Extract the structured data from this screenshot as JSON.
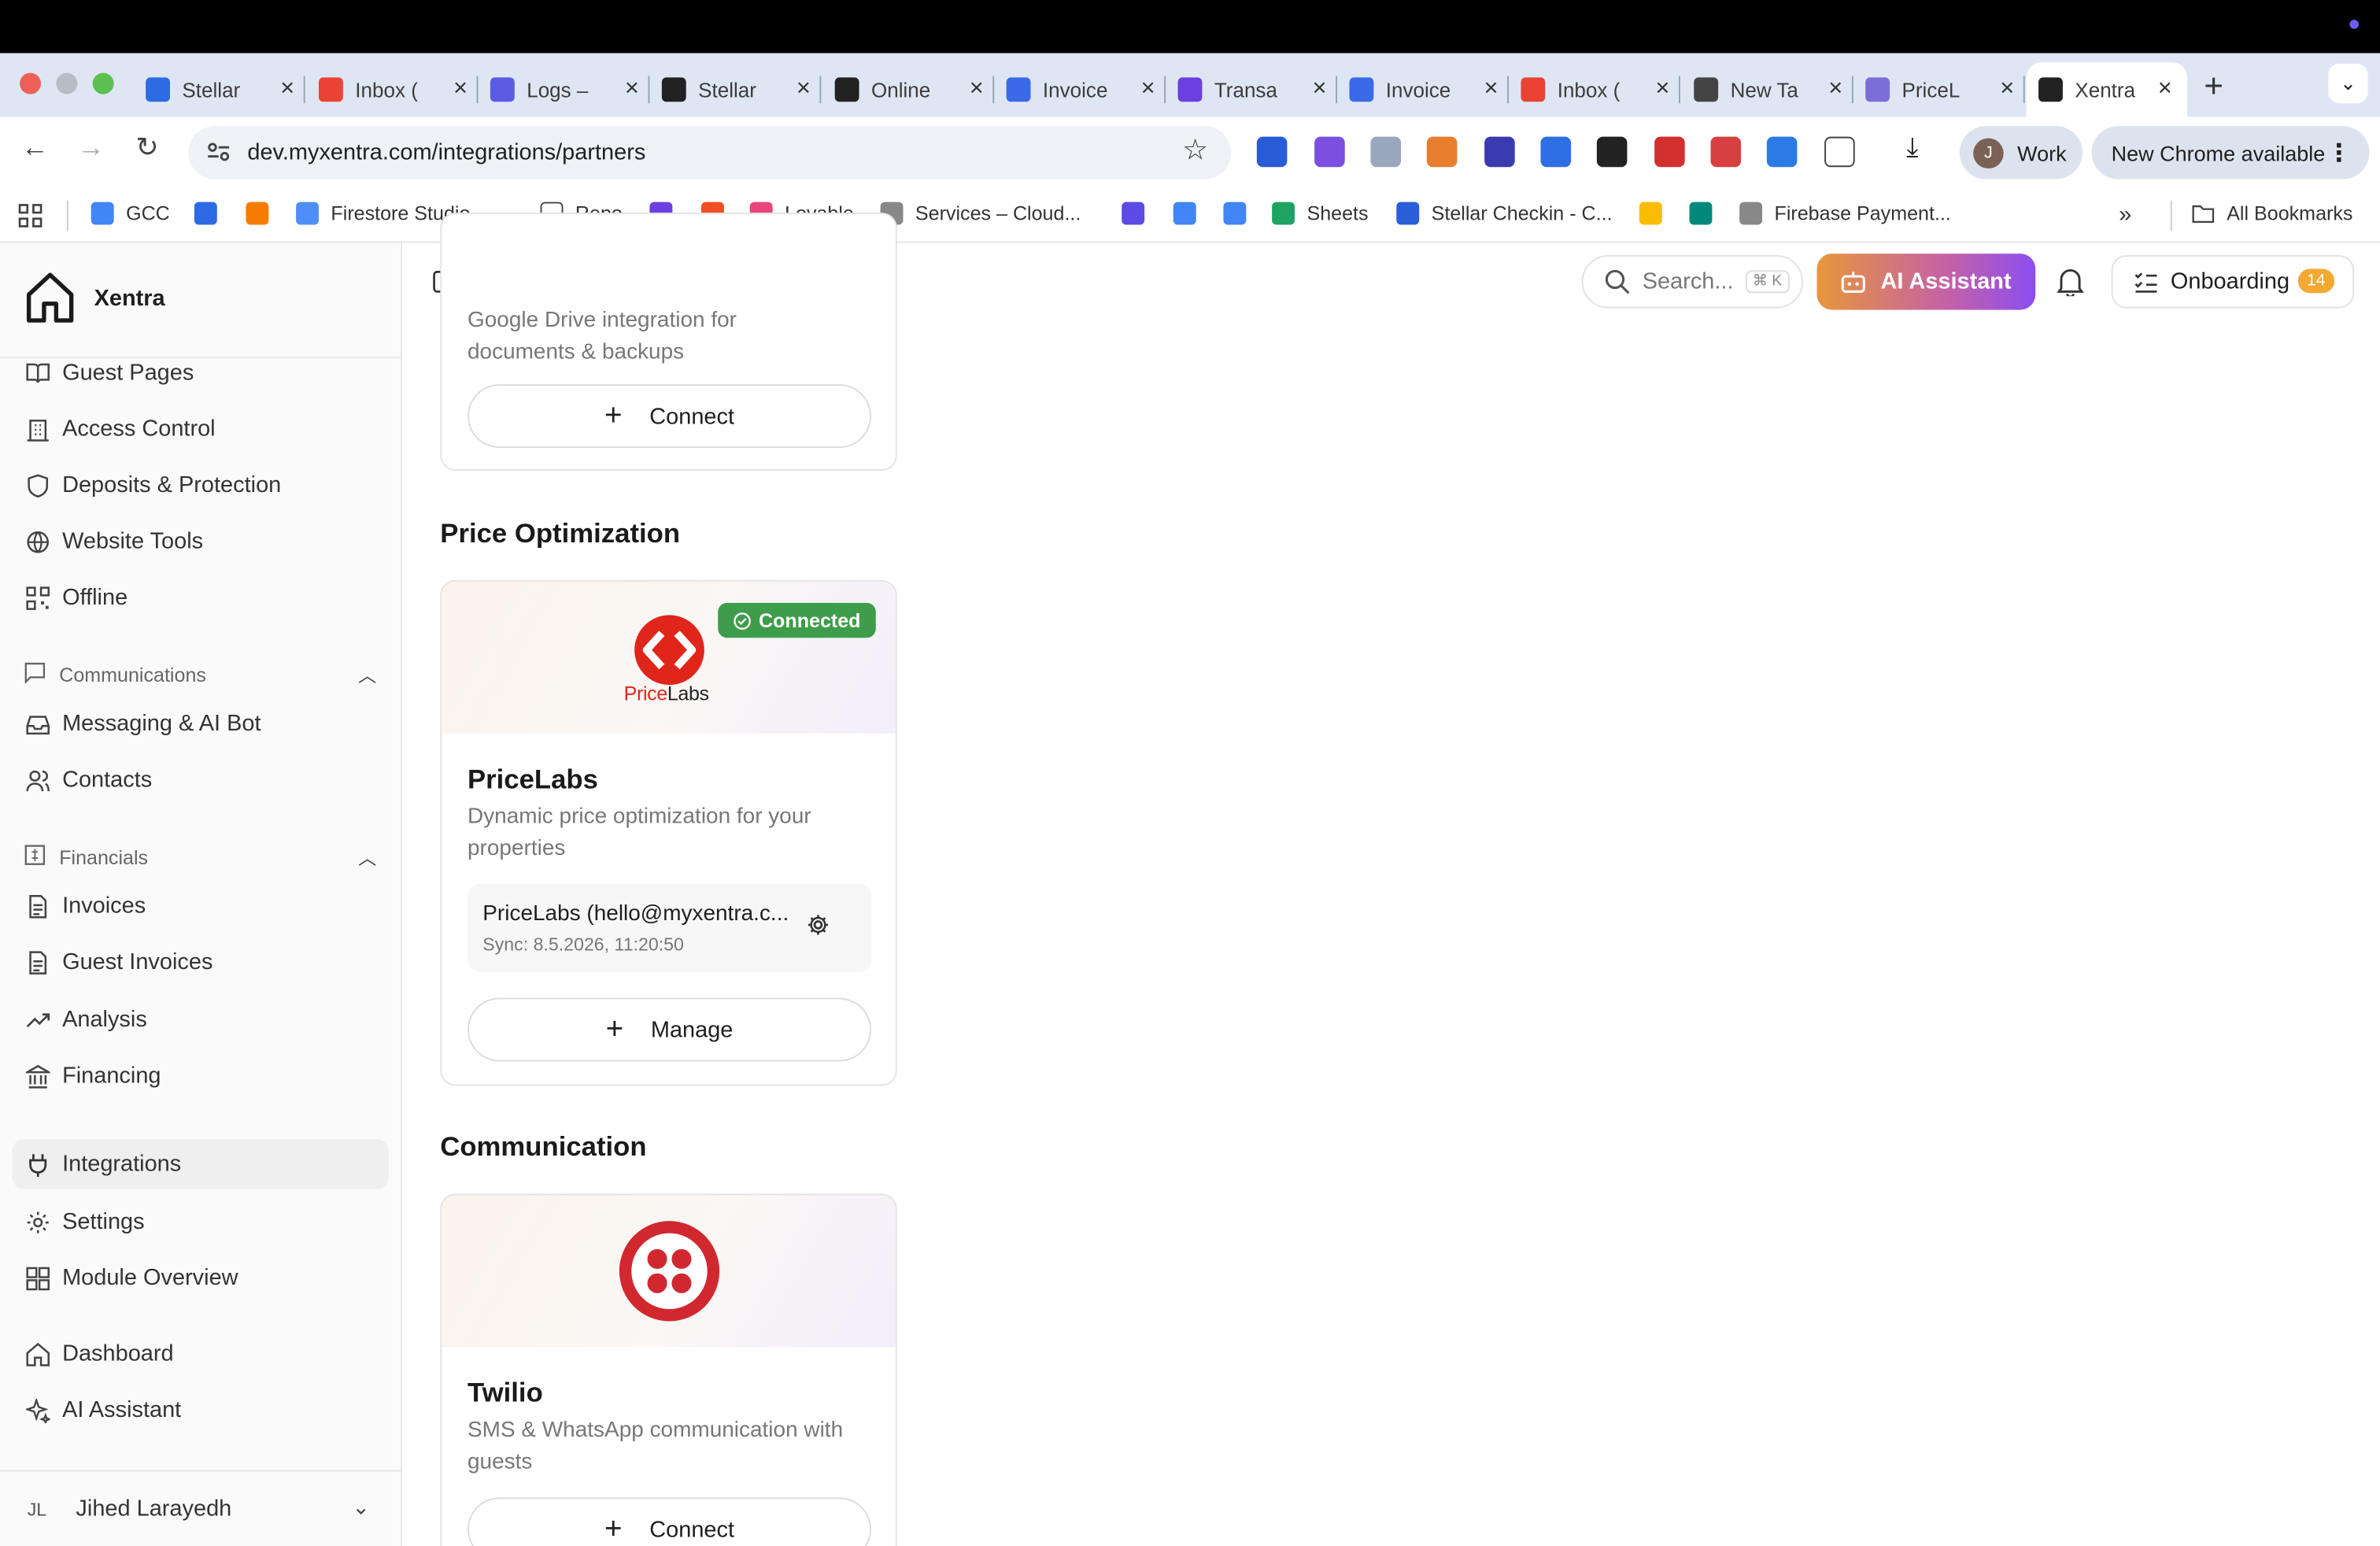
{
  "browser": {
    "tabs": [
      {
        "title": "Stellar",
        "icon": "stellar-tab-icon",
        "color": "#2d6be4"
      },
      {
        "title": "Inbox (",
        "icon": "gmail-icon",
        "color": "#ea4335"
      },
      {
        "title": "Logs –",
        "icon": "logs-tab-icon",
        "color": "#5b5be6"
      },
      {
        "title": "Stellar",
        "icon": "stellar-a-icon",
        "color": "#222222"
      },
      {
        "title": "Online",
        "icon": "online-a-icon",
        "color": "#222222"
      },
      {
        "title": "Invoice",
        "icon": "invoice-tab-icon",
        "color": "#3b6ae8"
      },
      {
        "title": "Transa",
        "icon": "transactions-tab-icon",
        "color": "#6b3fe0"
      },
      {
        "title": "Invoice",
        "icon": "invoice-tab-icon",
        "color": "#3b6ae8"
      },
      {
        "title": "Inbox (",
        "icon": "gmail-icon",
        "color": "#ea4335"
      },
      {
        "title": "New Ta",
        "icon": "chrome-icon",
        "color": "#444444"
      },
      {
        "title": "PriceL",
        "icon": "pricelabs-tab-icon",
        "color": "#7b6ed8"
      },
      {
        "title": "Xentra",
        "icon": "xentra-house-icon",
        "color": "#222222"
      }
    ],
    "url": "dev.myxentra.com/integrations/partners",
    "profile": {
      "initial": "J",
      "label": "Work"
    },
    "update_label": "New Chrome available",
    "bookmarks": [
      {
        "label": "GCC"
      },
      {
        "label": "Firestore Studio –..."
      },
      {
        "label": "Repo"
      },
      {
        "label": "Lovable"
      },
      {
        "label": "Services – Cloud..."
      },
      {
        "label": "Sheets"
      },
      {
        "label": "Stellar Checkin - C..."
      },
      {
        "label": "Firebase Payment..."
      }
    ],
    "all_bookmarks": "All Bookmarks"
  },
  "app": {
    "brand": "Xentra",
    "nav": {
      "guest_pages": "Guest Pages",
      "access_control": "Access Control",
      "deposits": "Deposits & Protection",
      "website_tools": "Website Tools",
      "offline": "Offline",
      "group_comm": "Communications",
      "messaging": "Messaging & AI Bot",
      "contacts": "Contacts",
      "group_fin": "Financials",
      "invoices": "Invoices",
      "guest_invoices": "Guest Invoices",
      "analysis": "Analysis",
      "financing": "Financing",
      "integrations": "Integrations",
      "settings": "Settings",
      "module_overview": "Module Overview",
      "dashboard": "Dashboard",
      "ai_assistant": "AI Assistant"
    },
    "user": {
      "initials": "JL",
      "name": "Jihed Larayedh"
    },
    "header": {
      "search_placeholder": "Search...",
      "search_kbd": "⌘ K",
      "ai_button": "AI Assistant",
      "onboarding": "Onboarding",
      "onboarding_count": "14"
    }
  },
  "content": {
    "top_card": {
      "desc": "Google Drive integration for documents & backups",
      "button": "Connect"
    },
    "sections": {
      "price": "Price Optimization",
      "communication": "Communication"
    },
    "pricelabs": {
      "logo_text_a": "Price",
      "logo_text_b": "Labs",
      "status": "Connected",
      "name": "PriceLabs",
      "desc": "Dynamic price optimization for your properties",
      "account": "PriceLabs (hello@myxentra.c...",
      "sync": "Sync: 8.5.2026, 11:20:50",
      "button": "Manage"
    },
    "twilio": {
      "name": "Twilio",
      "desc": "SMS & WhatsApp communication with guests",
      "button": "Connect"
    }
  },
  "colors": {
    "accent_ai_start": "#e8963b",
    "accent_ai_end": "#8c4ef0",
    "connected": "#3e9d4a",
    "pricelabs_red": "#e0261b",
    "twilio_red": "#d1282f",
    "onboarding_badge": "#f2a933"
  }
}
